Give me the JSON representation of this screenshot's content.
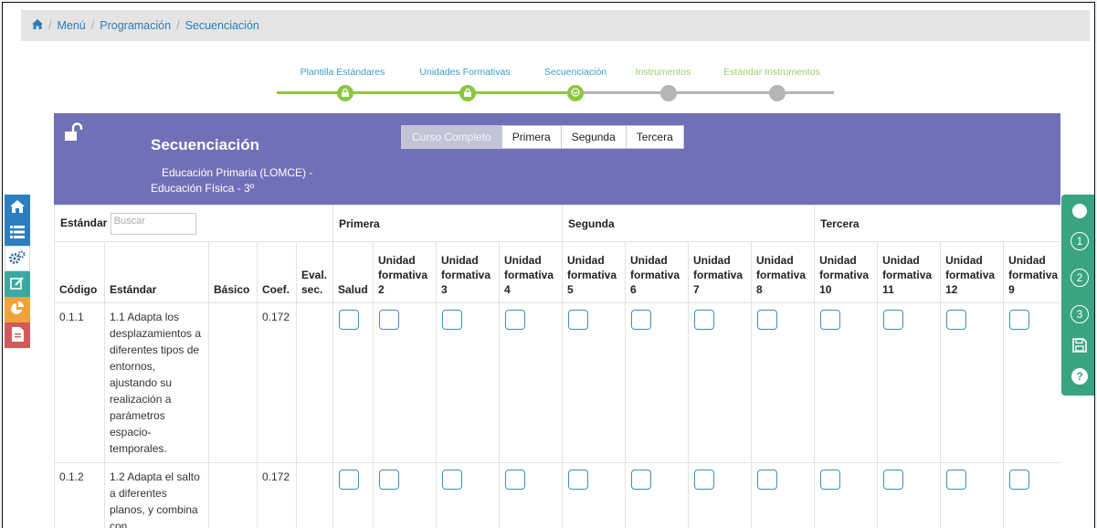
{
  "breadcrumb": {
    "home_icon": "home-icon",
    "items": [
      "Menú",
      "Programación",
      "Secuenciación"
    ]
  },
  "stepper": {
    "steps": [
      {
        "label": "Plantilla Estándares",
        "state": "done",
        "icon": "lock-icon"
      },
      {
        "label": "Unidades Formativas",
        "state": "done",
        "icon": "lock-icon"
      },
      {
        "label": "Secuenciación",
        "state": "current",
        "icon": "arrow-down-icon"
      },
      {
        "label": "Instrumentos",
        "state": "todo"
      },
      {
        "label": "Estándar Instrumentos",
        "state": "todo"
      }
    ],
    "colors": {
      "done_label": "#3a9cc8",
      "todo_label": "#9fcd6a",
      "green": "#8cc63f",
      "grey": "#b5b5b5"
    }
  },
  "panel": {
    "title": "Secuenciación",
    "subtitle_line1": "Educación Primaria (LOMCE) -",
    "subtitle_line2": "Educación Física - 3º",
    "color": "#7070b8",
    "tabs": [
      "Curso Completo",
      "Primera",
      "Segunda",
      "Tercera"
    ],
    "active_tab": "Curso Completo"
  },
  "table": {
    "group_row": {
      "estandar_label": "Estándar",
      "search_placeholder": "Buscar",
      "groups": [
        "Primera",
        "Segunda",
        "Tercera"
      ]
    },
    "columns": {
      "codigo": "Código",
      "estandar": "Estándar",
      "basico": "Básico",
      "coef": "Coef.",
      "eval_l1": "Eval.",
      "eval_l2": "sec.",
      "salud": "Salud",
      "uf_l1": "Unidad",
      "uf_l2": "formativa",
      "uf_nums": [
        "2",
        "3",
        "4",
        "5",
        "6",
        "7",
        "8",
        "10",
        "11",
        "12",
        "9"
      ]
    },
    "rows": [
      {
        "codigo": "0.1.1",
        "estandar": "1.1 Adapta los desplazamientos a diferentes tipos de entornos, ajustando su realización a parámetros espacio-temporales.",
        "basico": "",
        "coef": "0.172",
        "eval": ""
      },
      {
        "codigo": "0.1.2",
        "estandar": "1.2 Adapta el salto a diferentes planos, y combina con",
        "basico": "",
        "coef": "0.172",
        "eval": ""
      }
    ]
  },
  "left_toolbar": [
    {
      "icon": "home-icon",
      "color": "#2b7fc1"
    },
    {
      "icon": "list-icon",
      "color": "#2b7fc1"
    },
    {
      "icon": "gears-icon",
      "color": "#ffffff"
    },
    {
      "icon": "edit-icon",
      "color": "#3ba9a1"
    },
    {
      "icon": "pie-chart-icon",
      "color": "#efa33a"
    },
    {
      "icon": "document-icon",
      "color": "#d15a5a"
    }
  ],
  "right_toolbar": {
    "color": "#3aa482",
    "items": [
      {
        "icon": "circle-filled-icon",
        "text": ""
      },
      {
        "icon": "circle-one-icon",
        "text": "1"
      },
      {
        "icon": "circle-two-icon",
        "text": "2"
      },
      {
        "icon": "circle-three-icon",
        "text": "3"
      },
      {
        "icon": "save-icon",
        "text": ""
      },
      {
        "icon": "help-icon",
        "text": "?"
      }
    ]
  }
}
